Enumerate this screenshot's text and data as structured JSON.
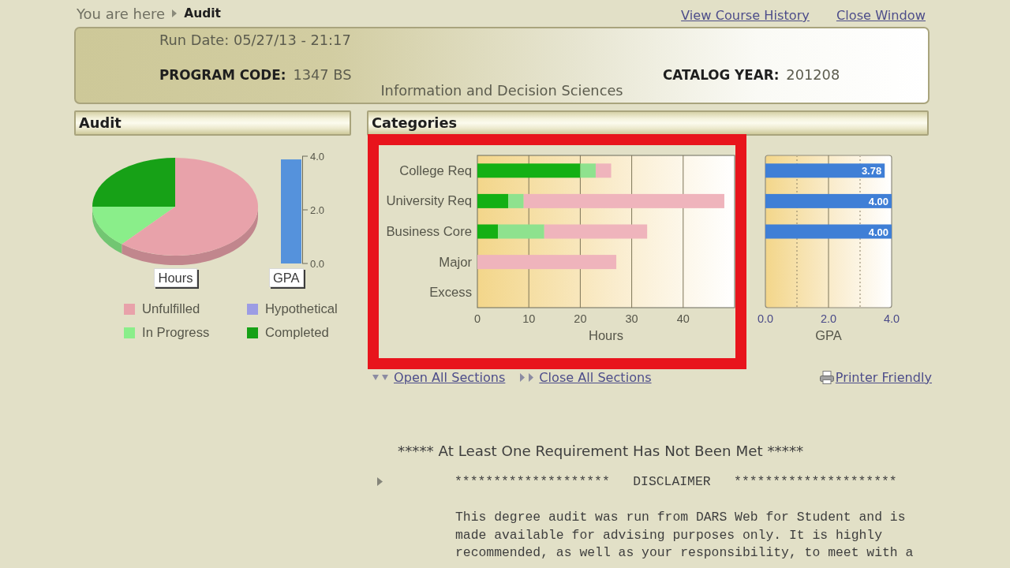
{
  "breadcrumb": {
    "prefix": "You are here",
    "current": "Audit"
  },
  "header_links": [
    {
      "label": "View Course History"
    },
    {
      "label": "Close Window"
    }
  ],
  "summary": {
    "run_date": "Run Date: 05/27/13 - 21:17",
    "program_code": {
      "label": "PROGRAM CODE:",
      "value": "1347 BS"
    },
    "catalog_year": {
      "label": "CATALOG YEAR:",
      "value": "201208"
    },
    "program_name": "Information and Decision Sciences"
  },
  "audit_panel": {
    "title": "Audit",
    "pie_label": "Hours",
    "gpa_gauge": {
      "chart_data": {
        "type": "bar",
        "categories": [
          "GPA"
        ],
        "series": [
          {
            "color": "#5592dc",
            "values": [
              3.88
            ]
          }
        ],
        "ylim": [
          0,
          4
        ],
        "yticks": [
          {
            "value": 0,
            "label": "0.0"
          },
          {
            "value": 2,
            "label": "2.0"
          },
          {
            "value": 4,
            "label": "4.0"
          }
        ]
      }
    },
    "legend": [
      {
        "label": "Unfulfilled",
        "color": "#e8a2aa"
      },
      {
        "label": "Hypothetical",
        "color": "#9c9ce4"
      },
      {
        "label": "In Progress",
        "color": "#8aee8a"
      },
      {
        "label": "Completed",
        "color": "#17a117"
      }
    ]
  },
  "categories_panel": {
    "title": "Categories",
    "highlighted": true,
    "hours_chart": {
      "chart_data": {
        "type": "bar",
        "orientation": "horizontal",
        "stacked": true,
        "xlabel": "Hours",
        "categories": [
          "College Req",
          "University Req",
          "Business Core",
          "Major",
          "Excess"
        ],
        "series": [
          {
            "color": "#14b014",
            "values": [
              20,
              6,
              4,
              null,
              null
            ]
          },
          {
            "color": "#8ee28e",
            "values": [
              3,
              3,
              9,
              null,
              null
            ]
          },
          {
            "color": "#efb4bc",
            "values": [
              3,
              39,
              20,
              27,
              null
            ]
          }
        ],
        "xlim": [
          0,
          50
        ],
        "xticks": [
          0,
          10,
          20,
          30,
          40
        ],
        "grid": true
      }
    },
    "gpa_chart": {
      "chart_data": {
        "type": "bar",
        "orientation": "horizontal",
        "xlabel": "GPA",
        "series": [
          {
            "color": "#3f7fd6",
            "values": [
              3.78,
              4.0,
              4.0,
              null,
              null
            ]
          }
        ],
        "value_labels": [
          "3.78",
          "4.00",
          "4.00",
          null,
          null
        ],
        "xlim": [
          0,
          4
        ],
        "xticks": [
          {
            "value": 0,
            "label": "0.0"
          },
          {
            "value": 2,
            "label": "2.0"
          },
          {
            "value": 4,
            "label": "4.0"
          }
        ],
        "grid": true
      }
    }
  },
  "section_links": [
    {
      "label": "Open All Sections",
      "kind": "expand"
    },
    {
      "label": "Close All Sections",
      "kind": "collapse"
    }
  ],
  "printer_link": {
    "label": "Printer Friendly"
  },
  "status_message": "***** At Least One Requirement Has Not Been Met *****",
  "disclaimer": {
    "heading": "********************   DISCLAIMER   *********************",
    "text": "This degree audit was run from DARS Web for Student and is\nmade available for advising purposes only. It is highly\nrecommended, as well as your responsibility, to meet with a"
  }
}
